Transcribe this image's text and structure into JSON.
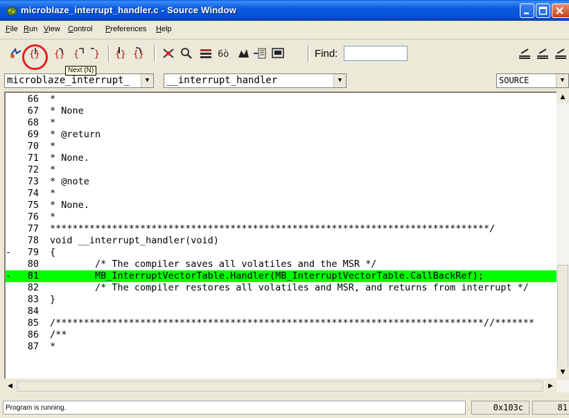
{
  "window": {
    "title": "microblaze_interrupt_handler.c - Source Window",
    "buttons": {
      "minimize": "minimize",
      "maximize": "maximize",
      "close": "close"
    }
  },
  "menu": {
    "items": [
      {
        "label": "File"
      },
      {
        "label": "Run"
      },
      {
        "label": "View"
      },
      {
        "label": "Control"
      },
      {
        "label": "Preferences"
      },
      {
        "label": "Help"
      }
    ]
  },
  "toolbar": {
    "tooltip": "Next (N)",
    "find_label": "Find:",
    "find_value": "",
    "highlight_color": "#e4201c"
  },
  "selectors": {
    "file": "microblaze_interrupt_",
    "function": "__interrupt_handler",
    "mode": "SOURCE"
  },
  "code": {
    "highlight_color": "#00ff00",
    "lines": [
      {
        "num": "66",
        "mark": "",
        "text": "*",
        "hl": false
      },
      {
        "num": "67",
        "mark": "",
        "text": "* None",
        "hl": false
      },
      {
        "num": "68",
        "mark": "",
        "text": "*",
        "hl": false
      },
      {
        "num": "69",
        "mark": "",
        "text": "* @return",
        "hl": false
      },
      {
        "num": "70",
        "mark": "",
        "text": "*",
        "hl": false
      },
      {
        "num": "71",
        "mark": "",
        "text": "* None.",
        "hl": false
      },
      {
        "num": "72",
        "mark": "",
        "text": "*",
        "hl": false
      },
      {
        "num": "73",
        "mark": "",
        "text": "* @note",
        "hl": false
      },
      {
        "num": "74",
        "mark": "",
        "text": "*",
        "hl": false
      },
      {
        "num": "75",
        "mark": "",
        "text": "* None.",
        "hl": false
      },
      {
        "num": "76",
        "mark": "",
        "text": "*",
        "hl": false
      },
      {
        "num": "77",
        "mark": "",
        "text": "******************************************************************************/",
        "hl": false
      },
      {
        "num": "78",
        "mark": "",
        "text": "void __interrupt_handler(void)",
        "hl": false
      },
      {
        "num": "79",
        "mark": "-",
        "text": "{",
        "hl": false
      },
      {
        "num": "80",
        "mark": "",
        "text": "        /* The compiler saves all volatiles and the MSR */",
        "hl": false
      },
      {
        "num": "81",
        "mark": "-",
        "text": "        MB_InterruptVectorTable.Handler(MB_InterruptVectorTable.CallBackRef);",
        "hl": true
      },
      {
        "num": "82",
        "mark": "",
        "text": "        /* The compiler restores all volatiles and MSR, and returns from interrupt */",
        "hl": false
      },
      {
        "num": "83",
        "mark": "",
        "text": "}",
        "hl": false
      },
      {
        "num": "84",
        "mark": "",
        "text": "",
        "hl": false
      },
      {
        "num": "85",
        "mark": "",
        "text": "/****************************************************************************//*******",
        "hl": false
      },
      {
        "num": "86",
        "mark": "",
        "text": "/**",
        "hl": false
      },
      {
        "num": "87",
        "mark": "",
        "text": "*",
        "hl": false
      }
    ]
  },
  "status": {
    "message": "Program is running.",
    "address": "0x103c",
    "column": "81"
  }
}
